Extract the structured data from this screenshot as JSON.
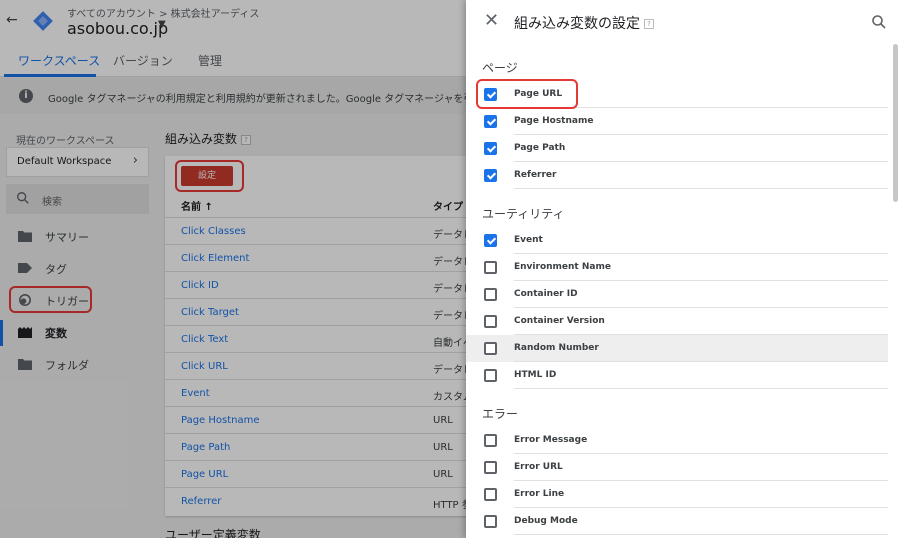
{
  "topbar": {
    "breadcrumb": "すべてのアカウント > 株式会社アーディス",
    "account": "asobou.co.jp"
  },
  "tabs": [
    {
      "label": "ワークスペース",
      "active": true
    },
    {
      "label": "バージョン",
      "active": false
    },
    {
      "label": "管理",
      "active": false
    }
  ],
  "notice": "Google タグマネージャの利用規定と利用規約が更新されました。Google タグマネージャを引き続き利用する",
  "sidebar": {
    "workspace_label": "現在のワークスペース",
    "workspace_name": "Default Workspace",
    "search_label": "検索",
    "items": [
      {
        "label": "サマリー",
        "icon": "folder-open-icon"
      },
      {
        "label": "タグ",
        "icon": "tag-icon"
      },
      {
        "label": "トリガー",
        "icon": "trigger-icon"
      },
      {
        "label": "変数",
        "icon": "variables-icon"
      },
      {
        "label": "フォルダ",
        "icon": "folder-icon"
      }
    ]
  },
  "main": {
    "section_title": "組み込み変数",
    "configure_button": "設定",
    "col_name": "名前 ↑",
    "col_type": "タイプ",
    "variables": [
      {
        "name": "Click Classes",
        "type": "データレ"
      },
      {
        "name": "Click Element",
        "type": "データレ"
      },
      {
        "name": "Click ID",
        "type": "データレ"
      },
      {
        "name": "Click Target",
        "type": "データレ"
      },
      {
        "name": "Click Text",
        "type": "自動イベ"
      },
      {
        "name": "Click URL",
        "type": "データレ"
      },
      {
        "name": "Event",
        "type": "カスタム"
      },
      {
        "name": "Page Hostname",
        "type": "URL"
      },
      {
        "name": "Page Path",
        "type": "URL"
      },
      {
        "name": "Page URL",
        "type": "URL"
      },
      {
        "name": "Referrer",
        "type": "HTTP 参"
      }
    ],
    "user_vars_title": "ユーザー定義変数"
  },
  "panel": {
    "title": "組み込み変数の設定",
    "sections": [
      {
        "title": "ページ",
        "items": [
          {
            "label": "Page URL",
            "checked": true
          },
          {
            "label": "Page Hostname",
            "checked": true
          },
          {
            "label": "Page Path",
            "checked": true
          },
          {
            "label": "Referrer",
            "checked": true
          }
        ]
      },
      {
        "title": "ユーティリティ",
        "items": [
          {
            "label": "Event",
            "checked": true
          },
          {
            "label": "Environment Name",
            "checked": false
          },
          {
            "label": "Container ID",
            "checked": false
          },
          {
            "label": "Container Version",
            "checked": false
          },
          {
            "label": "Random Number",
            "checked": false
          },
          {
            "label": "HTML ID",
            "checked": false
          }
        ]
      },
      {
        "title": "エラー",
        "items": [
          {
            "label": "Error Message",
            "checked": false
          },
          {
            "label": "Error URL",
            "checked": false
          },
          {
            "label": "Error Line",
            "checked": false
          },
          {
            "label": "Debug Mode",
            "checked": false
          }
        ]
      }
    ]
  },
  "colors": {
    "accent": "#1a73e8",
    "configure_button": "#c93c2e",
    "highlight_outline": "#e53935"
  }
}
